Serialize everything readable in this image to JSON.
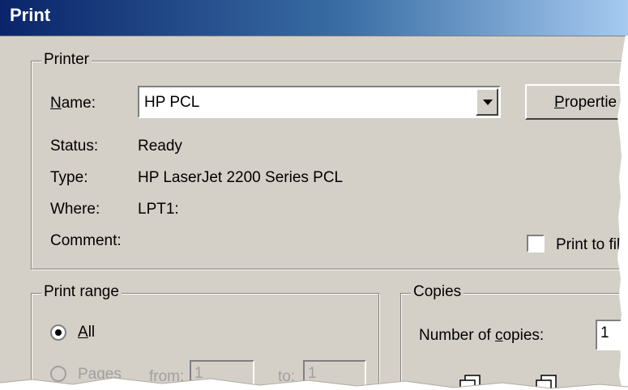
{
  "window": {
    "title": "Print"
  },
  "printer_group": {
    "legend": "Printer",
    "name_label_accel": "N",
    "name_label_rest": "ame:",
    "selected_printer": "HP PCL",
    "properties_accel": "P",
    "properties_rest": "ropertie",
    "status_label": "Status:",
    "status_value": "Ready",
    "type_label": "Type:",
    "type_value": "HP LaserJet 2200 Series PCL",
    "where_label": "Where:",
    "where_value": "LPT1:",
    "comment_label": "Comment:",
    "print_to_file_label": "Print to fil"
  },
  "print_range_group": {
    "legend": "Print range",
    "all_accel": "A",
    "all_rest": "ll",
    "all_selected": true,
    "pages_label": "Pages",
    "from_label": "from:",
    "from_value": "1",
    "to_label": "to:",
    "to_value": "1"
  },
  "copies_group": {
    "legend": "Copies",
    "number_label_pre": "Number of ",
    "number_label_accel": "c",
    "number_label_post": "opies:",
    "number_value": "1"
  },
  "icons": [
    "dropdown-arrow-icon",
    "copy-stack-icon"
  ],
  "colors": {
    "dialog_bg": "#d4d0c8",
    "title_start": "#0a246a",
    "title_end": "#a6caf0"
  }
}
